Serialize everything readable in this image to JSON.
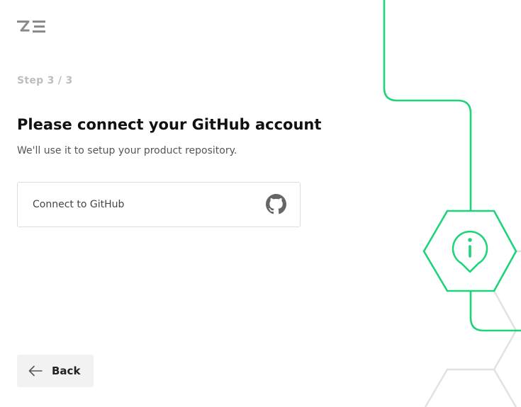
{
  "brand": {
    "logo_text": "ZE",
    "accent_color": "#1ed47a"
  },
  "wizard": {
    "step_label": "Step 3 / 3",
    "title": "Please connect your GitHub account",
    "subtitle": "We'll use it to setup your product repository."
  },
  "connect": {
    "label": "Connect to GitHub",
    "icon": "github-icon"
  },
  "footer": {
    "back_label": "Back",
    "back_icon": "arrow-left-icon"
  },
  "decoration": {
    "icon": "info-icon"
  }
}
